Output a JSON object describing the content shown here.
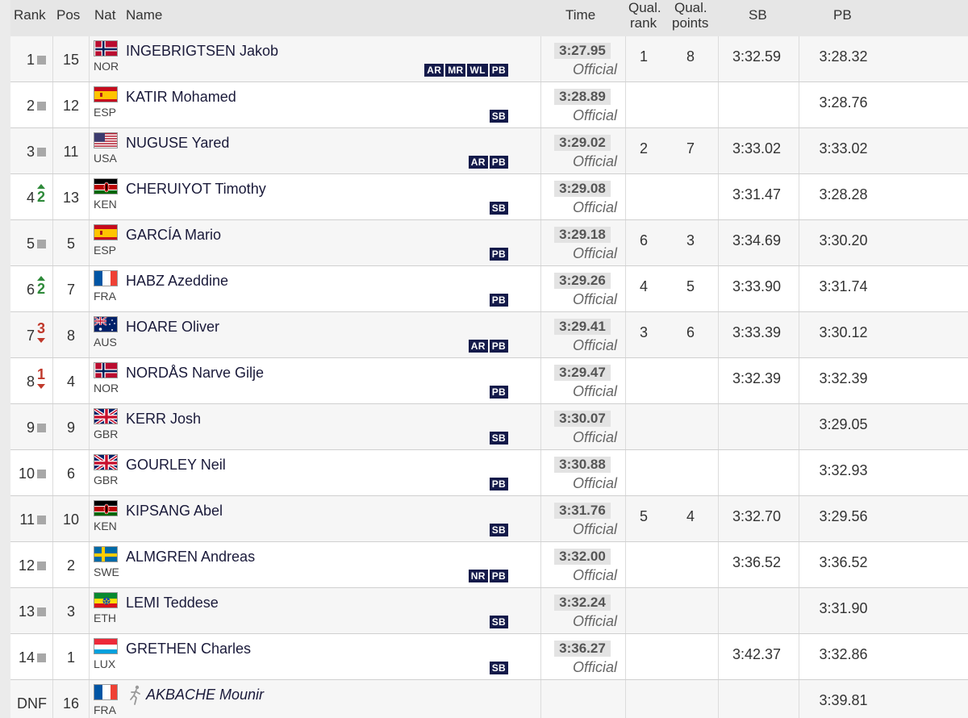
{
  "header": {
    "rank": "Rank",
    "pos": "Pos",
    "nat": "Nat",
    "name": "Name",
    "time": "Time",
    "qual_rank": [
      "Qual.",
      "rank"
    ],
    "qual_points": [
      "Qual.",
      "points"
    ],
    "sb": "SB",
    "pb": "PB"
  },
  "rows": [
    {
      "rank": "1",
      "move": "same",
      "move_num": "",
      "pos": "15",
      "flag": "NOR",
      "nat": "NOR",
      "name": "INGEBRIGTSEN Jakob",
      "badges": [
        "AR",
        "MR",
        "WL",
        "PB"
      ],
      "time": "3:27.95",
      "status": "Official",
      "qual_rank": "1",
      "qual_points": "8",
      "sb": "3:32.59",
      "pb": "3:28.32"
    },
    {
      "rank": "2",
      "move": "same",
      "move_num": "",
      "pos": "12",
      "flag": "ESP",
      "nat": "ESP",
      "name": "KATIR Mohamed",
      "badges": [
        "SB"
      ],
      "time": "3:28.89",
      "status": "Official",
      "qual_rank": "",
      "qual_points": "",
      "sb": "",
      "pb": "3:28.76"
    },
    {
      "rank": "3",
      "move": "same",
      "move_num": "",
      "pos": "11",
      "flag": "USA",
      "nat": "USA",
      "name": "NUGUSE Yared",
      "badges": [
        "AR",
        "PB"
      ],
      "time": "3:29.02",
      "status": "Official",
      "qual_rank": "2",
      "qual_points": "7",
      "sb": "3:33.02",
      "pb": "3:33.02"
    },
    {
      "rank": "4",
      "move": "up",
      "move_num": "2",
      "pos": "13",
      "flag": "KEN",
      "nat": "KEN",
      "name": "CHERUIYOT Timothy",
      "badges": [
        "SB"
      ],
      "time": "3:29.08",
      "status": "Official",
      "qual_rank": "",
      "qual_points": "",
      "sb": "3:31.47",
      "pb": "3:28.28"
    },
    {
      "rank": "5",
      "move": "same",
      "move_num": "",
      "pos": "5",
      "flag": "ESP",
      "nat": "ESP",
      "name": "GARCÍA Mario",
      "badges": [
        "PB"
      ],
      "time": "3:29.18",
      "status": "Official",
      "qual_rank": "6",
      "qual_points": "3",
      "sb": "3:34.69",
      "pb": "3:30.20"
    },
    {
      "rank": "6",
      "move": "up",
      "move_num": "2",
      "pos": "7",
      "flag": "FRA",
      "nat": "FRA",
      "name": "HABZ Azeddine",
      "badges": [
        "PB"
      ],
      "time": "3:29.26",
      "status": "Official",
      "qual_rank": "4",
      "qual_points": "5",
      "sb": "3:33.90",
      "pb": "3:31.74"
    },
    {
      "rank": "7",
      "move": "down",
      "move_num": "3",
      "pos": "8",
      "flag": "AUS",
      "nat": "AUS",
      "name": "HOARE Oliver",
      "badges": [
        "AR",
        "PB"
      ],
      "time": "3:29.41",
      "status": "Official",
      "qual_rank": "3",
      "qual_points": "6",
      "sb": "3:33.39",
      "pb": "3:30.12"
    },
    {
      "rank": "8",
      "move": "down",
      "move_num": "1",
      "pos": "4",
      "flag": "NOR",
      "nat": "NOR",
      "name": "NORDÅS Narve Gilje",
      "badges": [
        "PB"
      ],
      "time": "3:29.47",
      "status": "Official",
      "qual_rank": "",
      "qual_points": "",
      "sb": "3:32.39",
      "pb": "3:32.39"
    },
    {
      "rank": "9",
      "move": "same",
      "move_num": "",
      "pos": "9",
      "flag": "GBR",
      "nat": "GBR",
      "name": "KERR Josh",
      "badges": [
        "SB"
      ],
      "time": "3:30.07",
      "status": "Official",
      "qual_rank": "",
      "qual_points": "",
      "sb": "",
      "pb": "3:29.05"
    },
    {
      "rank": "10",
      "move": "same",
      "move_num": "",
      "pos": "6",
      "flag": "GBR",
      "nat": "GBR",
      "name": "GOURLEY Neil",
      "badges": [
        "PB"
      ],
      "time": "3:30.88",
      "status": "Official",
      "qual_rank": "",
      "qual_points": "",
      "sb": "",
      "pb": "3:32.93"
    },
    {
      "rank": "11",
      "move": "same",
      "move_num": "",
      "pos": "10",
      "flag": "KEN",
      "nat": "KEN",
      "name": "KIPSANG Abel",
      "badges": [
        "SB"
      ],
      "time": "3:31.76",
      "status": "Official",
      "qual_rank": "5",
      "qual_points": "4",
      "sb": "3:32.70",
      "pb": "3:29.56"
    },
    {
      "rank": "12",
      "move": "same",
      "move_num": "",
      "pos": "2",
      "flag": "SWE",
      "nat": "SWE",
      "name": "ALMGREN Andreas",
      "badges": [
        "NR",
        "PB"
      ],
      "time": "3:32.00",
      "status": "Official",
      "qual_rank": "",
      "qual_points": "",
      "sb": "3:36.52",
      "pb": "3:36.52"
    },
    {
      "rank": "13",
      "move": "same",
      "move_num": "",
      "pos": "3",
      "flag": "ETH",
      "nat": "ETH",
      "name": "LEMI Teddese",
      "badges": [
        "SB"
      ],
      "time": "3:32.24",
      "status": "Official",
      "qual_rank": "",
      "qual_points": "",
      "sb": "",
      "pb": "3:31.90"
    },
    {
      "rank": "14",
      "move": "same",
      "move_num": "",
      "pos": "1",
      "flag": "LUX",
      "nat": "LUX",
      "name": "GRETHEN Charles",
      "badges": [
        "SB"
      ],
      "time": "3:36.27",
      "status": "Official",
      "qual_rank": "",
      "qual_points": "",
      "sb": "3:42.37",
      "pb": "3:32.86"
    },
    {
      "rank": "DNF",
      "move": "none",
      "move_num": "",
      "pos": "16",
      "flag": "FRA",
      "nat": "FRA",
      "name": "AKBACHE Mounir",
      "badges": [],
      "time": "",
      "status": "",
      "qual_rank": "",
      "qual_points": "",
      "sb": "",
      "pb": "3:39.81",
      "runner_icon": "runner-icon"
    }
  ],
  "colors": {
    "header_bg": "#e6e6e6",
    "badge_bg": "#141a4a",
    "move_up": "#2e8a3a",
    "move_down": "#c0392b",
    "move_same": "#a8a8a8"
  }
}
